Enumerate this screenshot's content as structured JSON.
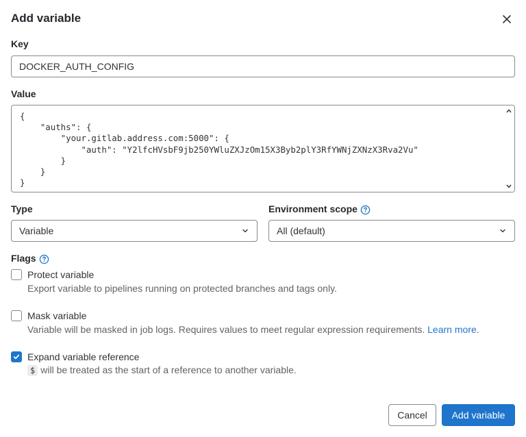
{
  "modal": {
    "title": "Add variable"
  },
  "key": {
    "label": "Key",
    "value": "DOCKER_AUTH_CONFIG"
  },
  "value_field": {
    "label": "Value",
    "text": "{\n    \"auths\": {\n        \"your.gitlab.address.com:5000\": {\n            \"auth\": \"Y2lfcHVsbF9jb250YWluZXJzOm15X3Byb2plY3RfYWNjZXNzX3Rva2Vu\"\n        }\n    }\n}"
  },
  "type": {
    "label": "Type",
    "selected": "Variable"
  },
  "environment_scope": {
    "label": "Environment scope",
    "selected": "All (default)"
  },
  "flags": {
    "label": "Flags",
    "protect": {
      "label": "Protect variable",
      "help": "Export variable to pipelines running on protected branches and tags only.",
      "checked": false
    },
    "mask": {
      "label": "Mask variable",
      "help": "Variable will be masked in job logs. Requires values to meet regular expression requirements.",
      "link": "Learn more",
      "link_suffix": ".",
      "checked": false
    },
    "expand": {
      "label": "Expand variable reference",
      "code": "$",
      "help": "will be treated as the start of a reference to another variable.",
      "checked": true
    }
  },
  "footer": {
    "cancel_label": "Cancel",
    "confirm_label": "Add variable"
  },
  "colors": {
    "primary": "#1f75cb",
    "border": "#89888d",
    "text": "#333238",
    "muted": "#626168"
  },
  "icons": {
    "close": "close-icon",
    "help": "question-circle-icon",
    "chevron": "chevron-down-icon",
    "check": "check-icon"
  }
}
